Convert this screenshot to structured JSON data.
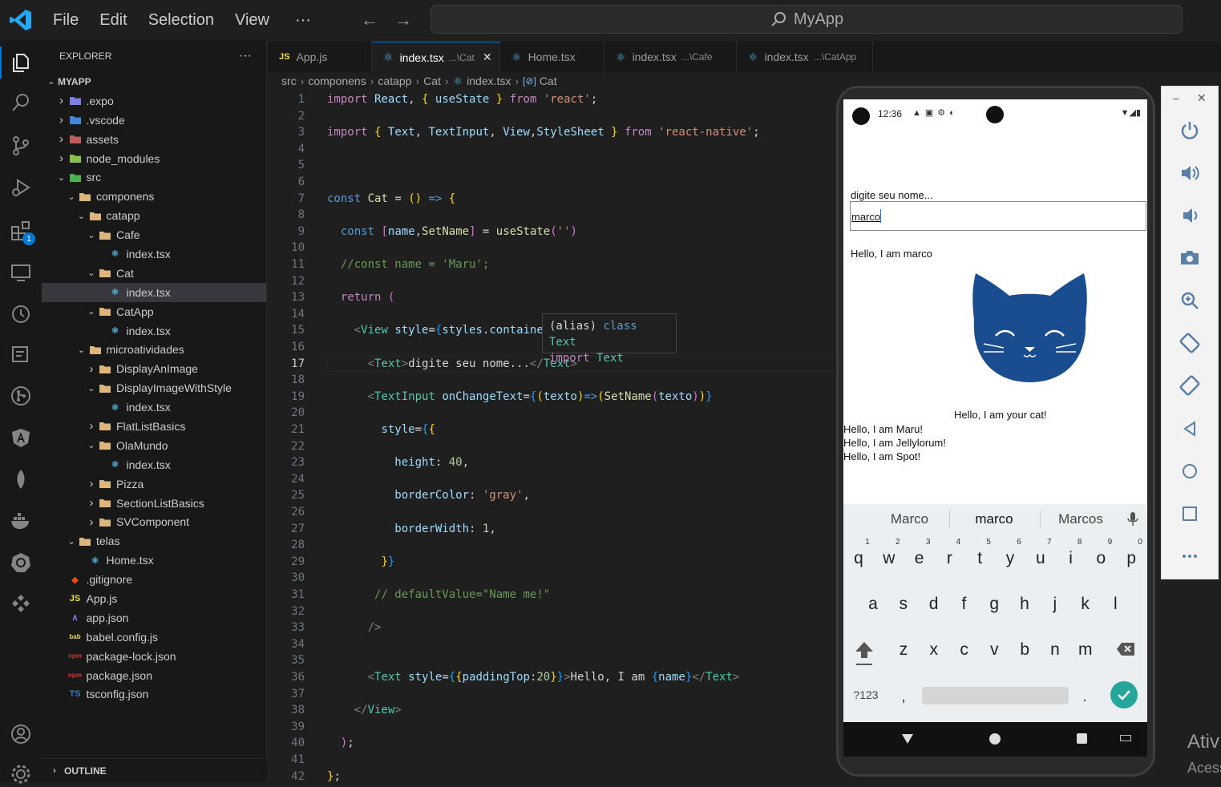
{
  "titlebar": {
    "menu": [
      "File",
      "Edit",
      "Selection",
      "View"
    ],
    "more": "···",
    "search_text": "MyApp"
  },
  "sidebar": {
    "title": "EXPLORER",
    "more": "···",
    "tree": [
      {
        "label": "MYAPP",
        "depth": 0,
        "type": "root",
        "chev": "open"
      },
      {
        "label": ".expo",
        "depth": 1,
        "type": "folder-expo",
        "chev": "closed"
      },
      {
        "label": ".vscode",
        "depth": 1,
        "type": "folder-vscode",
        "chev": "closed"
      },
      {
        "label": "assets",
        "depth": 1,
        "type": "folder-assets",
        "chev": "closed"
      },
      {
        "label": "node_modules",
        "depth": 1,
        "type": "folder-node",
        "chev": "closed"
      },
      {
        "label": "src",
        "depth": 1,
        "type": "folder-src",
        "chev": "open"
      },
      {
        "label": "componens",
        "depth": 2,
        "type": "folder",
        "chev": "open"
      },
      {
        "label": "catapp",
        "depth": 3,
        "type": "folder",
        "chev": "open"
      },
      {
        "label": "Cafe",
        "depth": 4,
        "type": "folder",
        "chev": "open"
      },
      {
        "label": "index.tsx",
        "depth": 5,
        "type": "react",
        "chev": ""
      },
      {
        "label": "Cat",
        "depth": 4,
        "type": "folder",
        "chev": "open"
      },
      {
        "label": "index.tsx",
        "depth": 5,
        "type": "react",
        "chev": "",
        "selected": true
      },
      {
        "label": "CatApp",
        "depth": 4,
        "type": "folder",
        "chev": "open"
      },
      {
        "label": "index.tsx",
        "depth": 5,
        "type": "react",
        "chev": ""
      },
      {
        "label": "microatividades",
        "depth": 3,
        "type": "folder",
        "chev": "open"
      },
      {
        "label": "DisplayAnImage",
        "depth": 4,
        "type": "folder",
        "chev": "closed"
      },
      {
        "label": "DisplayImageWithStyle",
        "depth": 4,
        "type": "folder",
        "chev": "open"
      },
      {
        "label": "index.tsx",
        "depth": 5,
        "type": "react",
        "chev": ""
      },
      {
        "label": "FlatListBasics",
        "depth": 4,
        "type": "folder",
        "chev": "closed"
      },
      {
        "label": "OlaMundo",
        "depth": 4,
        "type": "folder",
        "chev": "open"
      },
      {
        "label": "index.tsx",
        "depth": 5,
        "type": "react",
        "chev": ""
      },
      {
        "label": "Pizza",
        "depth": 4,
        "type": "folder",
        "chev": "closed"
      },
      {
        "label": "SectionListBasics",
        "depth": 4,
        "type": "folder",
        "chev": "closed"
      },
      {
        "label": "SVComponent",
        "depth": 4,
        "type": "folder",
        "chev": "closed"
      },
      {
        "label": "telas",
        "depth": 2,
        "type": "folder",
        "chev": "open"
      },
      {
        "label": "Home.tsx",
        "depth": 3,
        "type": "react",
        "chev": ""
      },
      {
        "label": ".gitignore",
        "depth": 1,
        "type": "git",
        "chev": ""
      },
      {
        "label": "App.js",
        "depth": 1,
        "type": "js",
        "chev": ""
      },
      {
        "label": "app.json",
        "depth": 1,
        "type": "expojson",
        "chev": ""
      },
      {
        "label": "babel.config.js",
        "depth": 1,
        "type": "babel",
        "chev": ""
      },
      {
        "label": "package-lock.json",
        "depth": 1,
        "type": "npm",
        "chev": ""
      },
      {
        "label": "package.json",
        "depth": 1,
        "type": "npm",
        "chev": ""
      },
      {
        "label": "tsconfig.json",
        "depth": 1,
        "type": "ts",
        "chev": ""
      }
    ],
    "outline": "OUTLINE"
  },
  "tabs": [
    {
      "icon": "JS",
      "label": "App.js",
      "hint": "",
      "active": false
    },
    {
      "icon": "react",
      "label": "index.tsx",
      "hint": "...\\Cat",
      "active": true
    },
    {
      "icon": "react",
      "label": "Home.tsx",
      "hint": "",
      "active": false
    },
    {
      "icon": "react",
      "label": "index.tsx",
      "hint": "...\\Cafe",
      "active": false
    },
    {
      "icon": "react",
      "label": "index.tsx",
      "hint": "...\\CatApp",
      "active": false
    }
  ],
  "breadcrumb": [
    "src",
    "componens",
    "catapp",
    "Cat",
    "index.tsx",
    "Cat"
  ],
  "editor": {
    "current_line": 17
  },
  "hover": {
    "line1_a": "(alias)",
    "line1_b": "class",
    "line1_c": "Text",
    "line2_a": "import",
    "line2_b": "Text"
  },
  "phone": {
    "time": "12:36",
    "prompt_label": "digite seu nome...",
    "input_value": "marco",
    "hello_name": "Hello, I am marco",
    "hello_cat": "Hello, I am your cat!",
    "cat_lines": [
      "Hello, I am Maru!",
      "Hello, I am Jellylorum!",
      "Hello, I am Spot!"
    ],
    "suggestions": [
      "Marco",
      "marco",
      "Marcos"
    ],
    "row1": [
      "q",
      "w",
      "e",
      "r",
      "t",
      "y",
      "u",
      "i",
      "o",
      "p"
    ],
    "row1_sup": [
      "1",
      "2",
      "3",
      "4",
      "5",
      "6",
      "7",
      "8",
      "9",
      "0"
    ],
    "row2": [
      "a",
      "s",
      "d",
      "f",
      "g",
      "h",
      "j",
      "k",
      "l"
    ],
    "row3": [
      "z",
      "x",
      "c",
      "v",
      "b",
      "n",
      "m"
    ],
    "sym": "?123",
    "comma": ",",
    "period": "."
  },
  "watermark": {
    "line1": "Ativ",
    "line2": "Acess"
  },
  "colors": {
    "accent": "#0078d4",
    "cat_blue": "#1a4d8f",
    "confirm": "#26a69a"
  }
}
